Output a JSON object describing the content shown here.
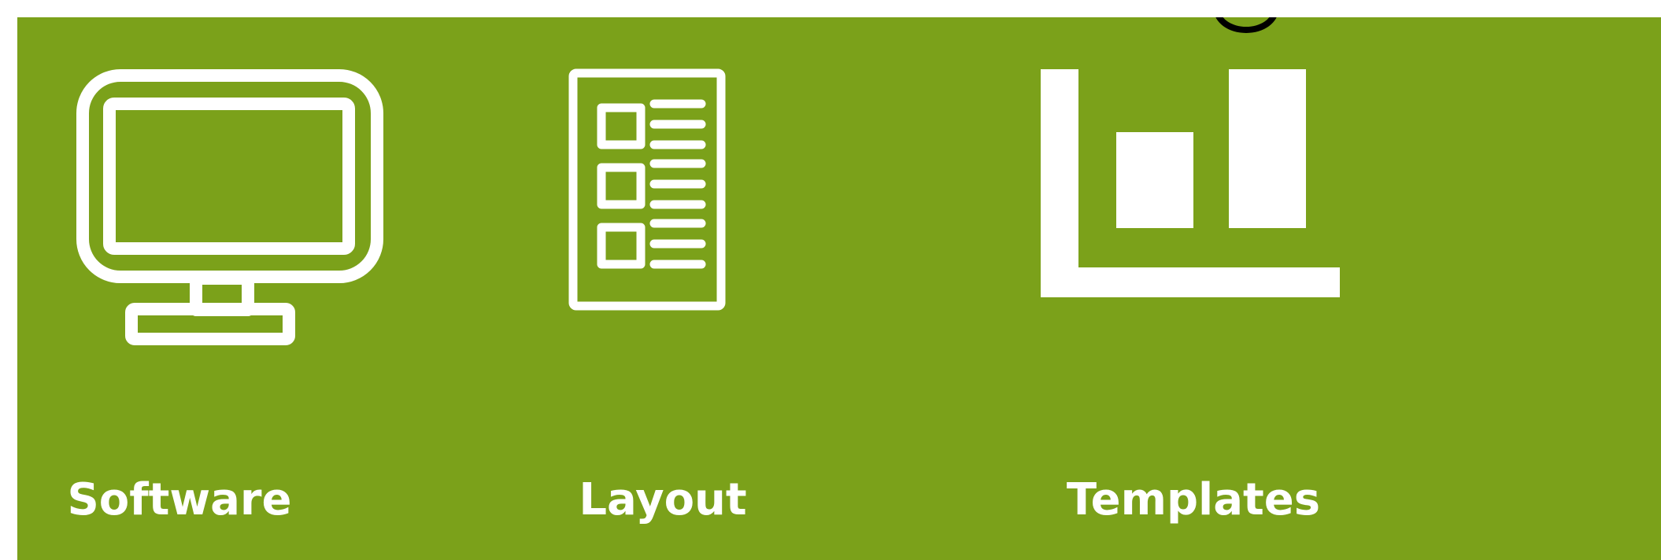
{
  "colors": {
    "panel_background": "#7ba11a",
    "icon": "#ffffff",
    "label": "#ffffff",
    "page_background": "#ffffff"
  },
  "features": [
    {
      "label": "Software",
      "icon": "monitor-icon"
    },
    {
      "label": "Layout",
      "icon": "document-layout-icon"
    },
    {
      "label": "Templates",
      "icon": "bar-chart-icon"
    }
  ]
}
